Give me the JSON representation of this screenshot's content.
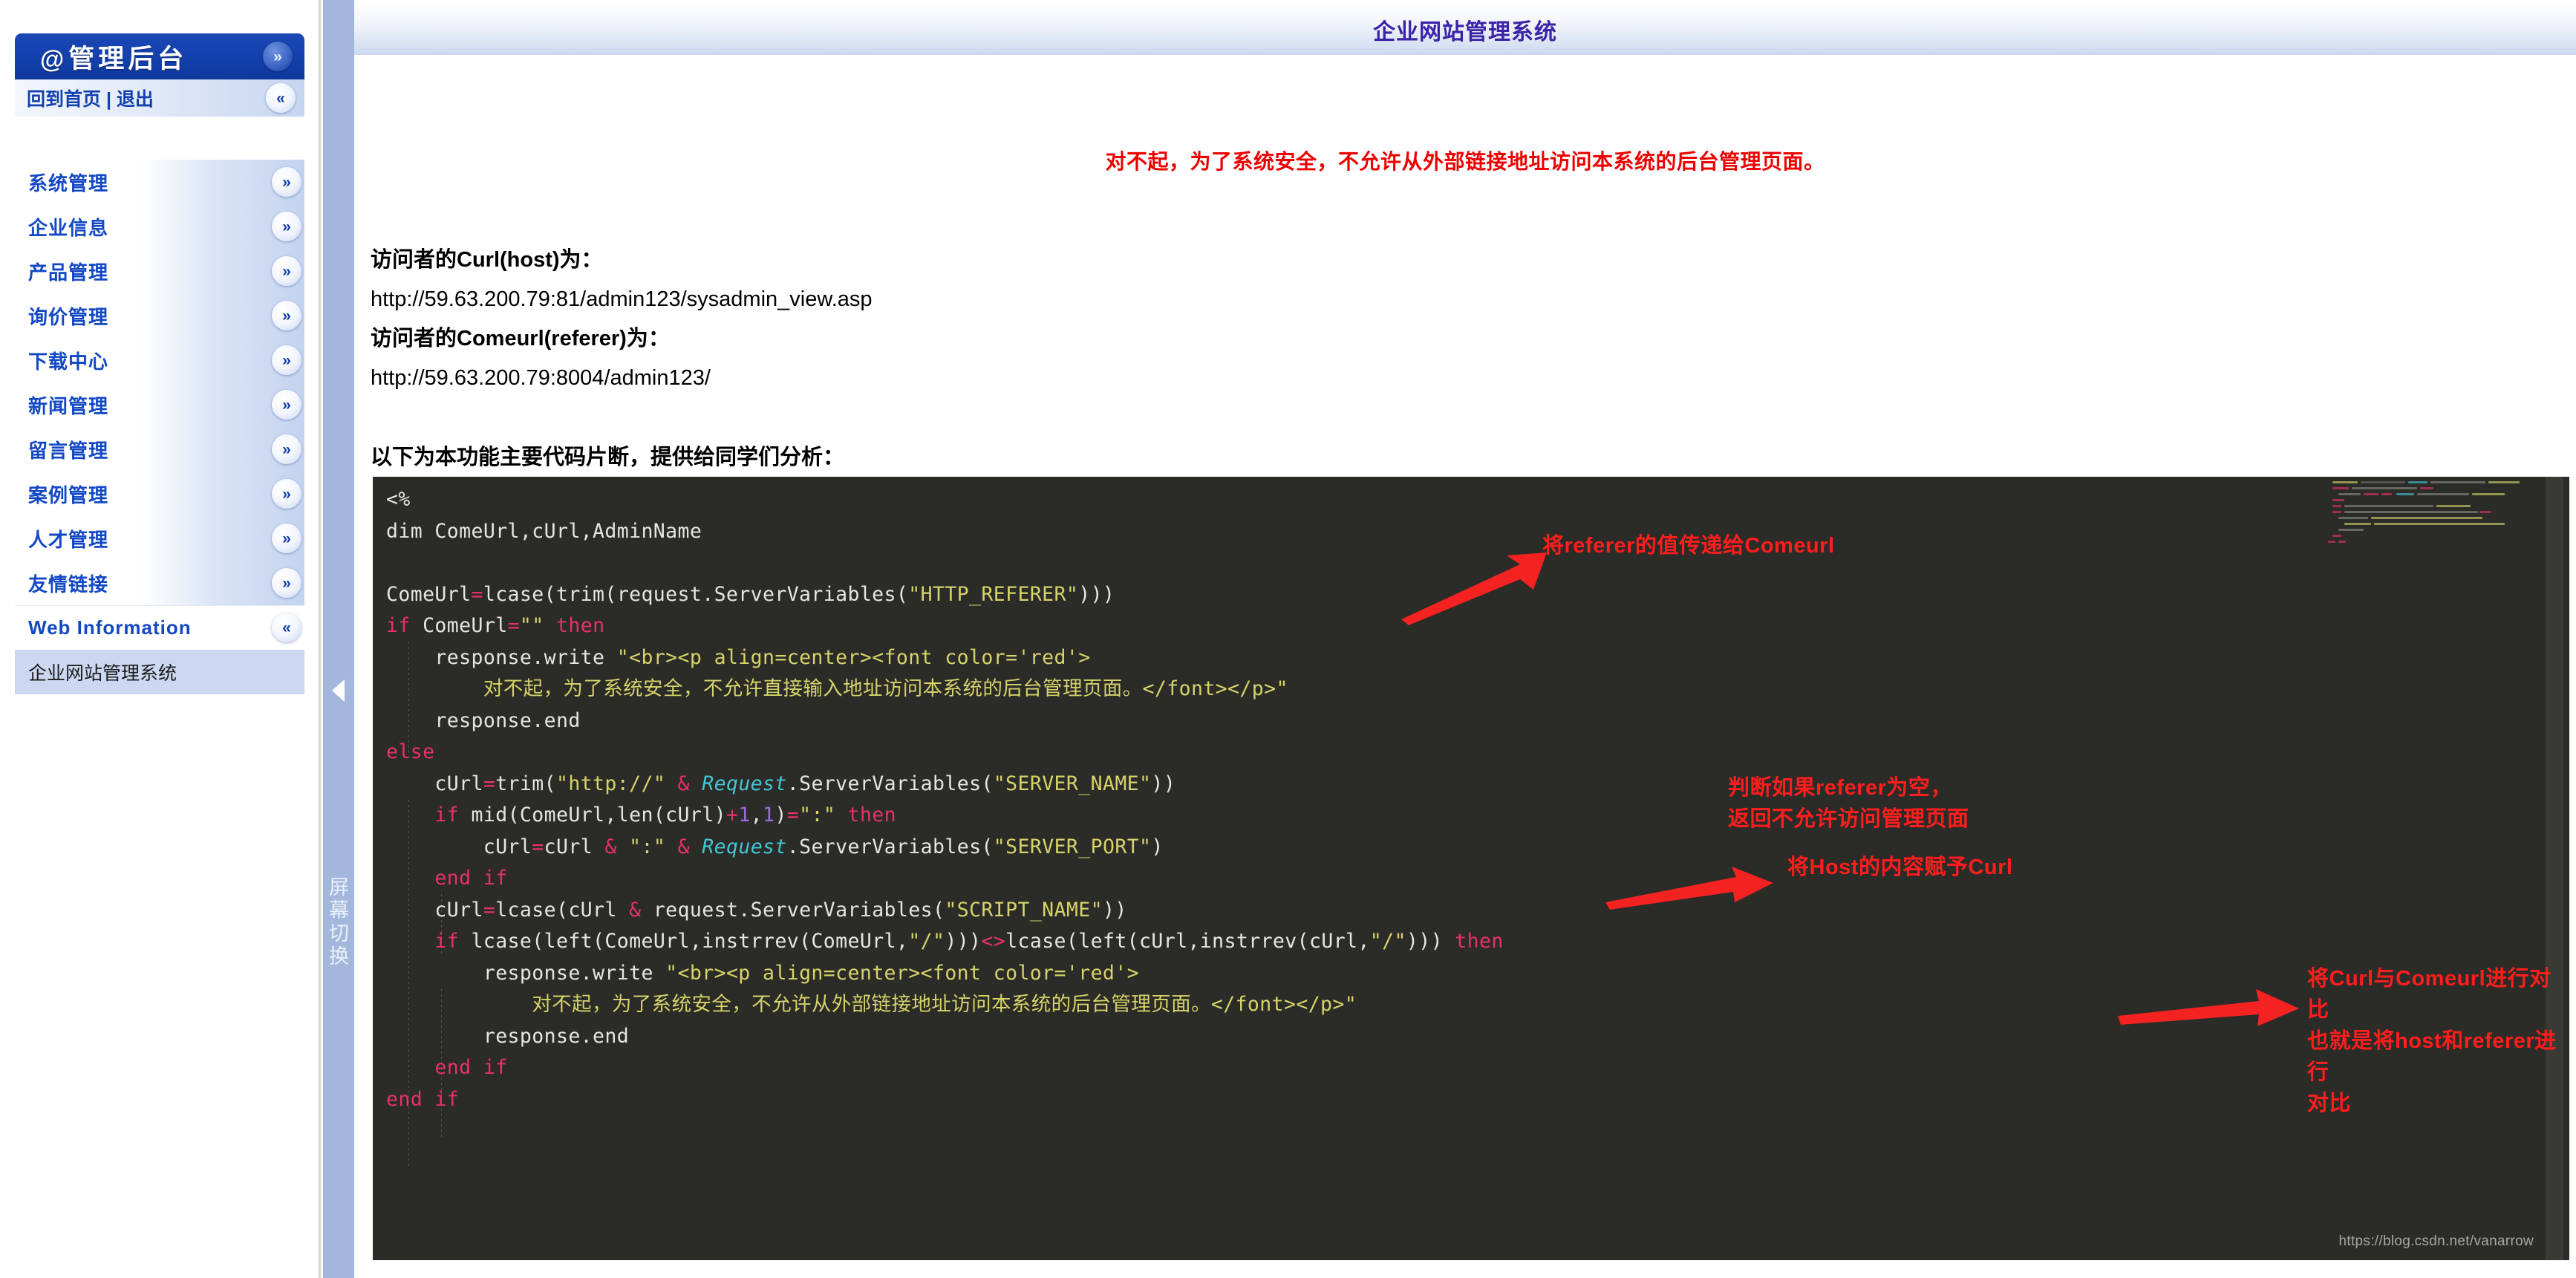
{
  "sidebar": {
    "logo": {
      "at_icon": "@",
      "title": "管理后台",
      "toggle_icon": "chevron-double-down"
    },
    "top_links": {
      "label": "回到首页 | 退出",
      "collapse_icon": "chevron-double-left"
    },
    "items": [
      {
        "label": "系统管理",
        "icon": "chevron-double-down"
      },
      {
        "label": "企业信息",
        "icon": "chevron-double-down"
      },
      {
        "label": "产品管理",
        "icon": "chevron-double-down"
      },
      {
        "label": "询价管理",
        "icon": "chevron-double-down"
      },
      {
        "label": "下载中心",
        "icon": "chevron-double-down"
      },
      {
        "label": "新闻管理",
        "icon": "chevron-double-down"
      },
      {
        "label": "留言管理",
        "icon": "chevron-double-down"
      },
      {
        "label": "案例管理",
        "icon": "chevron-double-down"
      },
      {
        "label": "人才管理",
        "icon": "chevron-double-down"
      },
      {
        "label": "友情链接",
        "icon": "chevron-double-down"
      }
    ],
    "web_information": {
      "label": "Web Information",
      "icon": "chevron-double-left"
    },
    "submenu_active": {
      "label": "企业网站管理系统"
    }
  },
  "collapse_bar": {
    "arrow_icon": "triangle-left",
    "label": "屏幕切换"
  },
  "header": {
    "title": "企业网站管理系统"
  },
  "alert": {
    "message": "对不起，为了系统安全，不允许从外部链接地址访问本系统的后台管理页面。"
  },
  "info": {
    "curl_label": "访问者的Curl(host)为：",
    "curl_value": "http://59.63.200.79:81/admin123/sysadmin_view.asp",
    "comeurl_label": "访问者的Comeurl(referer)为：",
    "comeurl_value": "http://59.63.200.79:8004/admin123/"
  },
  "code_heading": "以下为本功能主要代码片断，提供给同学们分析：",
  "code": {
    "lines": [
      "<%",
      "dim ComeUrl,cUrl,AdminName",
      "",
      "ComeUrl=lcase(trim(request.ServerVariables(\"HTTP_REFERER\")))",
      "if ComeUrl=\"\" then",
      "    response.write \"<br><p align=center><font color='red'>",
      "        对不起，为了系统安全，不允许直接输入地址访问本系统的后台管理页面。</font></p>\"",
      "    response.end",
      "else",
      "    cUrl=trim(\"http://\" & Request.ServerVariables(\"SERVER_NAME\"))",
      "    if mid(ComeUrl,len(cUrl)+1,1)=\":\" then",
      "        cUrl=cUrl & \":\" & Request.ServerVariables(\"SERVER_PORT\")",
      "    end if",
      "    cUrl=lcase(cUrl & request.ServerVariables(\"SCRIPT_NAME\"))",
      "    if lcase(left(ComeUrl,instrrev(ComeUrl,\"/\")))<>lcase(left(cUrl,instrrev(cUrl,\"/\"))) then",
      "        response.write \"<br><p align=center><font color='red'>",
      "            对不起，为了系统安全，不允许从外部链接地址访问本系统的后台管理页面。</font></p>\"",
      "        response.end",
      "    end if",
      "end if"
    ]
  },
  "annotations": [
    {
      "id": "a1",
      "text": "将referer的值传递给Comeurl"
    },
    {
      "id": "a2",
      "text": "判断如果referer为空，\n返回不允许访问管理页面"
    },
    {
      "id": "a3",
      "text": "将Host的内容赋予Curl"
    },
    {
      "id": "a4",
      "text": "将Curl与Comeurl进行对比\n也就是将host和referer进行\n对比"
    }
  ],
  "watermark": {
    "text": "https://blog.csdn.net/vanarrow"
  },
  "colors": {
    "brand_blue": "#1340ad",
    "link_blue": "#1348c4",
    "title_purple": "#3b22a8",
    "alert_red": "#ee0000",
    "annotation_red": "#ff1d1d",
    "code_bg": "#2b2b27",
    "code_string": "#d6d36a",
    "code_keyword": "#e8316b",
    "code_object": "#45c4d6",
    "divider_blue": "#a3b7dd",
    "submenu_bg": "#ccd7f2"
  }
}
